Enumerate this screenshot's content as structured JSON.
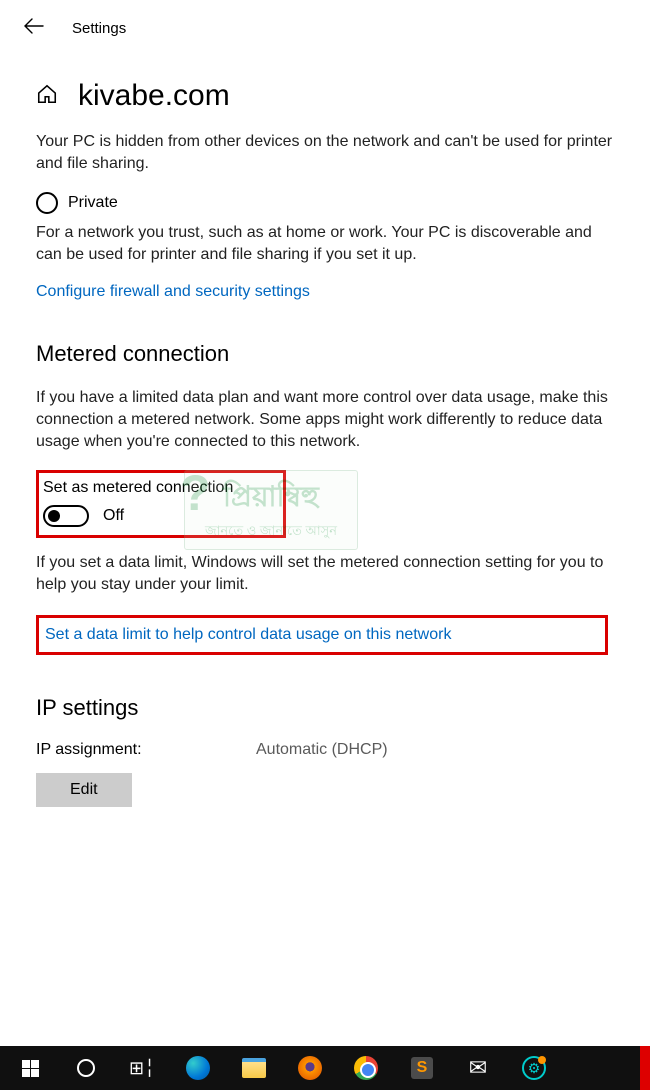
{
  "header": {
    "title": "Settings"
  },
  "page": {
    "title": "kivabe.com",
    "hidden_text": "Your PC is hidden from other devices on the network and can't be used for printer and file sharing.",
    "private_label": "Private",
    "private_desc": "For a network you trust, such as at home or work. Your PC is discoverable and can be used for printer and file sharing if you set it up.",
    "firewall_link": "Configure firewall and security settings"
  },
  "metered": {
    "heading": "Metered connection",
    "desc": "If you have a limited data plan and want more control over data usage, make this connection a metered network. Some apps might work differently to reduce data usage when you're connected to this network.",
    "toggle_label": "Set as metered connection",
    "toggle_state": "Off",
    "limit_desc": "If you set a data limit, Windows will set the metered connection setting for you to help you stay under your limit.",
    "limit_link": "Set a data limit to help control data usage on this network"
  },
  "ip": {
    "heading": "IP settings",
    "assign_label": "IP assignment:",
    "assign_value": "Automatic (DHCP)",
    "edit_btn": "Edit"
  },
  "watermark": {
    "top": "প্রিয়াম্বিহু",
    "bottom": "জানতে ও জানাতে আসুন"
  },
  "colors": {
    "link": "#0067c0",
    "highlight": "#d90000"
  }
}
